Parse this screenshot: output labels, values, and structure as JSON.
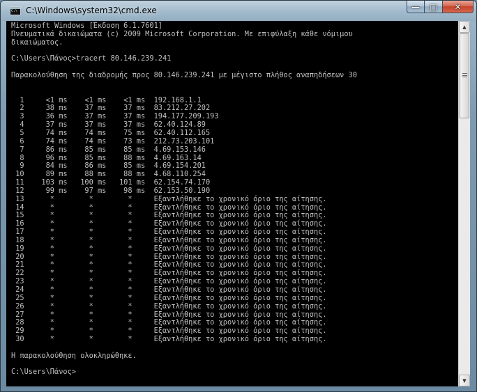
{
  "window": {
    "title": "C:\\Windows\\system32\\cmd.exe",
    "minimize_label": "—",
    "maximize_label": "□",
    "close_label": "✕"
  },
  "console": {
    "lines": [
      "Microsoft Windows [Έκδοση 6.1.7601]",
      "Πνευματικά δικαιώματα (c) 2009 Microsoft Corporation. Με επιφύλαξη κάθε νόμιμου",
      "δικαιώματος.",
      "",
      "C:\\Users\\Πάνος>tracert 80.146.239.241",
      "",
      "Παρακολούθηση της διαδρομής προς 80.146.239.241 με μέγιστο πλήθος αναπηδήσεων 30",
      "",
      "",
      "  1     <1 ms    <1 ms    <1 ms  192.168.1.1",
      "  2     38 ms    37 ms    37 ms  83.212.27.202",
      "  3     36 ms    37 ms    37 ms  194.177.209.193",
      "  4     37 ms    37 ms    37 ms  62.40.124.89",
      "  5     74 ms    74 ms    75 ms  62.40.112.165",
      "  6     74 ms    74 ms    73 ms  212.73.203.101",
      "  7     86 ms    85 ms    85 ms  4.69.153.146",
      "  8     96 ms    85 ms    88 ms  4.69.163.14",
      "  9     84 ms    86 ms    85 ms  4.69.154.201",
      " 10     89 ms    88 ms    88 ms  4.68.110.254",
      " 11    103 ms   100 ms   101 ms  62.154.74.170",
      " 12     99 ms    97 ms    98 ms  62.153.50.190",
      " 13      *        *        *     Εξαντλήθηκε το χρονικό όριο της αίτησης.",
      " 14      *        *        *     Εξαντλήθηκε το χρονικό όριο της αίτησης.",
      " 15      *        *        *     Εξαντλήθηκε το χρονικό όριο της αίτησης.",
      " 16      *        *        *     Εξαντλήθηκε το χρονικό όριο της αίτησης.",
      " 17      *        *        *     Εξαντλήθηκε το χρονικό όριο της αίτησης.",
      " 18      *        *        *     Εξαντλήθηκε το χρονικό όριο της αίτησης.",
      " 19      *        *        *     Εξαντλήθηκε το χρονικό όριο της αίτησης.",
      " 20      *        *        *     Εξαντλήθηκε το χρονικό όριο της αίτησης.",
      " 21      *        *        *     Εξαντλήθηκε το χρονικό όριο της αίτησης.",
      " 22      *        *        *     Εξαντλήθηκε το χρονικό όριο της αίτησης.",
      " 23      *        *        *     Εξαντλήθηκε το χρονικό όριο της αίτησης.",
      " 24      *        *        *     Εξαντλήθηκε το χρονικό όριο της αίτησης.",
      " 25      *        *        *     Εξαντλήθηκε το χρονικό όριο της αίτησης.",
      " 26      *        *        *     Εξαντλήθηκε το χρονικό όριο της αίτησης.",
      " 27      *        *        *     Εξαντλήθηκε το χρονικό όριο της αίτησης.",
      " 28      *        *        *     Εξαντλήθηκε το χρονικό όριο της αίτησης.",
      " 29      *        *        *     Εξαντλήθηκε το χρονικό όριο της αίτησης.",
      " 30      *        *        *     Εξαντλήθηκε το χρονικό όριο της αίτησης.",
      "",
      "Η παρακολούθηση ολοκληρώθηκε.",
      "",
      "C:\\Users\\Πάνος>"
    ]
  },
  "scrollbar": {
    "up_arrow": "▲",
    "down_arrow": "▼",
    "position_fraction": 0.0
  },
  "colors": {
    "console_background": "#000000",
    "console_text": "#c0c0c0",
    "close_button": "#c4412a"
  }
}
